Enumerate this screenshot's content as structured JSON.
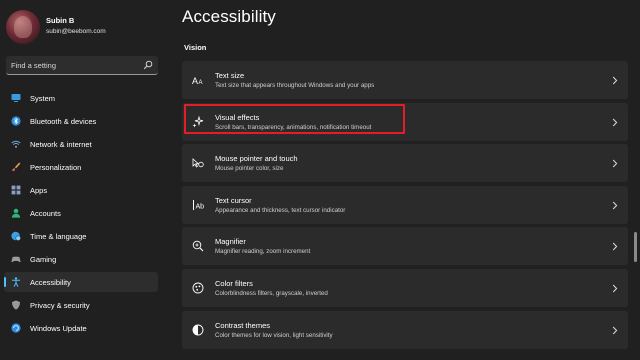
{
  "profile": {
    "name": "Subin B",
    "email": "subin@beebom.com"
  },
  "search": {
    "placeholder": "Find a setting"
  },
  "nav": {
    "items": [
      {
        "label": "System",
        "icon": "monitor-icon",
        "color": "#3a9bdc"
      },
      {
        "label": "Bluetooth & devices",
        "icon": "bluetooth-icon",
        "color": "#2f8fe0"
      },
      {
        "label": "Network & internet",
        "icon": "wifi-icon",
        "color": "#6fa8dc"
      },
      {
        "label": "Personalization",
        "icon": "brush-icon",
        "color": "#e0a050"
      },
      {
        "label": "Apps",
        "icon": "apps-icon",
        "color": "#8a9fc8"
      },
      {
        "label": "Accounts",
        "icon": "person-icon",
        "color": "#32b37a"
      },
      {
        "label": "Time & language",
        "icon": "globe-clock-icon",
        "color": "#3ba0e0"
      },
      {
        "label": "Gaming",
        "icon": "controller-icon",
        "color": "#9a9a9a"
      },
      {
        "label": "Accessibility",
        "icon": "accessibility-icon",
        "color": "#4cc2ff",
        "selected": true
      },
      {
        "label": "Privacy & security",
        "icon": "shield-icon",
        "color": "#9a9a9a"
      },
      {
        "label": "Windows Update",
        "icon": "update-icon",
        "color": "#2f8fe0"
      }
    ]
  },
  "main": {
    "title": "Accessibility",
    "section": "Vision",
    "cards": [
      {
        "title": "Text size",
        "subtitle": "Text size that appears throughout Windows and your apps",
        "icon": "text-size-icon"
      },
      {
        "title": "Visual effects",
        "subtitle": "Scroll bars, transparency, animations, notification timeout",
        "icon": "sparkle-icon",
        "highlighted": true
      },
      {
        "title": "Mouse pointer and touch",
        "subtitle": "Mouse pointer color, size",
        "icon": "pointer-touch-icon"
      },
      {
        "title": "Text cursor",
        "subtitle": "Appearance and thickness, text cursor indicator",
        "icon": "text-cursor-icon"
      },
      {
        "title": "Magnifier",
        "subtitle": "Magnifier reading, zoom increment",
        "icon": "magnifier-icon"
      },
      {
        "title": "Color filters",
        "subtitle": "Colorblindness filters, grayscale, inverted",
        "icon": "color-filter-icon"
      },
      {
        "title": "Contrast themes",
        "subtitle": "Color themes for low vision, light sensitivity",
        "icon": "contrast-icon"
      }
    ]
  },
  "colors": {
    "accent": "#4cc2ff",
    "highlight_border": "#e81c24",
    "background": "#202020",
    "card": "#2b2b2b"
  }
}
